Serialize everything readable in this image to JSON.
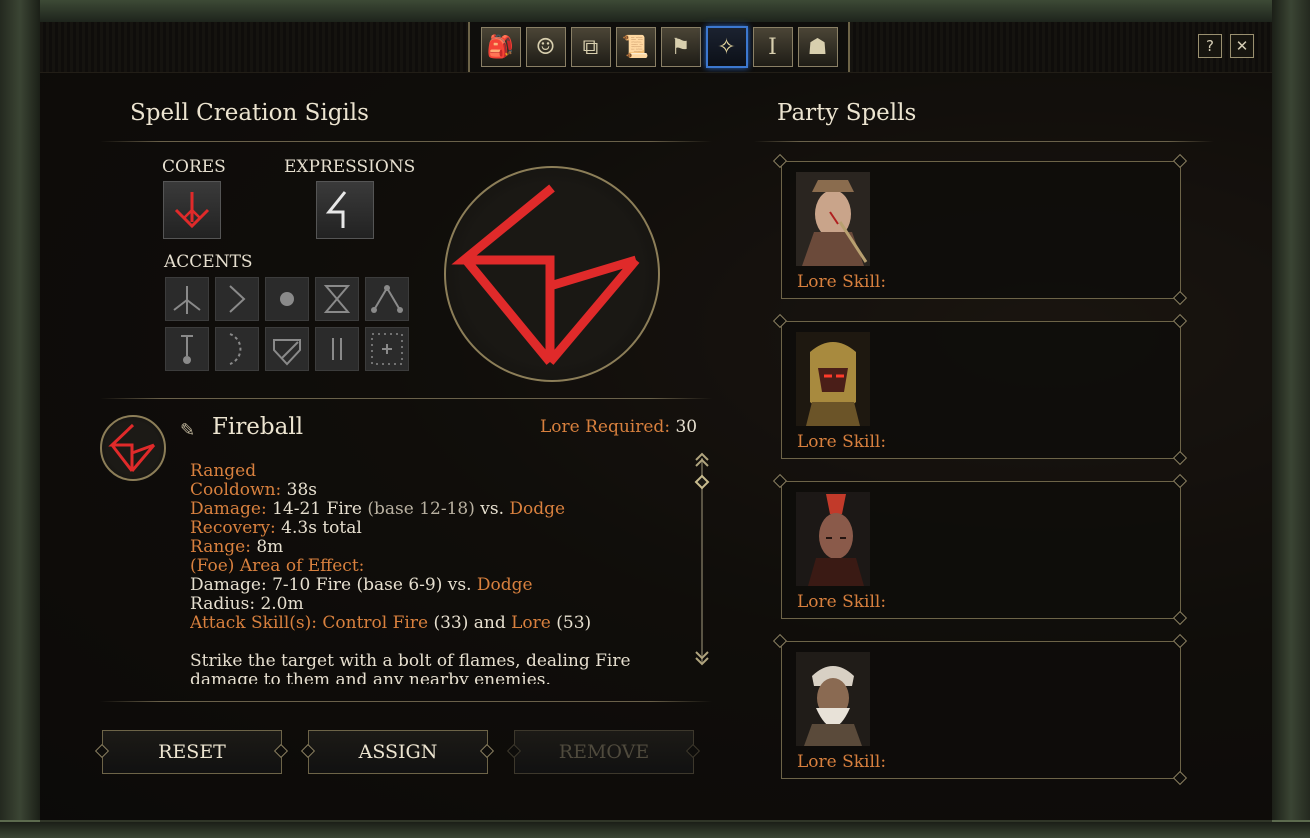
{
  "window": {
    "tabs": [
      {
        "name": "inventory-tab-icon",
        "glyph": "🎒"
      },
      {
        "name": "character-tab-icon",
        "glyph": "☺"
      },
      {
        "name": "party-tab-icon",
        "glyph": "⧉"
      },
      {
        "name": "journal-tab-icon",
        "glyph": "📜"
      },
      {
        "name": "reputation-tab-icon",
        "glyph": "⚑"
      },
      {
        "name": "grimoire-tab-icon",
        "glyph": "✧"
      },
      {
        "name": "stronghold-tab-icon",
        "glyph": "Ⅰ"
      },
      {
        "name": "map-tab-icon",
        "glyph": "☗"
      }
    ],
    "active_tab": 5,
    "help_label": "?",
    "close_label": "✕"
  },
  "left": {
    "title": "Spell Creation Sigils",
    "cores_label": "CORES",
    "expressions_label": "EXPRESSIONS",
    "accents_label": "ACCENTS",
    "spell": {
      "name": "Fireball",
      "lore_required_label": "Lore Required:",
      "lore_required_value": "30",
      "lines": [
        {
          "label": "Ranged",
          "value": ""
        },
        {
          "label": "Cooldown:",
          "value": "38s"
        },
        {
          "label": "Damage:",
          "value": "14-21 Fire",
          "extra": "(base 12-18)",
          "vs": "vs.",
          "target": "Dodge"
        },
        {
          "label": "Recovery:",
          "value": "4.3s total"
        },
        {
          "label": "Range:",
          "value": "8m"
        },
        {
          "label": "(Foe) Area of Effect:",
          "value": ""
        },
        {
          "plain": "Damage: 7-10 Fire (base 6-9) vs.",
          "target": "Dodge"
        },
        {
          "plain": "Radius: 2.0m"
        },
        {
          "label": "Attack Skill(s):",
          "skill1": "Control Fire",
          "skill1_val": "(33)",
          "and": "and",
          "skill2": "Lore",
          "skill2_val": "(53)"
        }
      ],
      "description": "Strike the target with a bolt of flames, dealing Fire damage to them and any nearby enemies."
    },
    "buttons": {
      "reset": "RESET",
      "assign": "ASSIGN",
      "remove": "REMOVE"
    }
  },
  "right": {
    "title": "Party Spells",
    "members": [
      {
        "lore_label": "Lore Skill:",
        "palette": [
          "#c9a48a",
          "#6b4a3a",
          "#8a6c4e"
        ]
      },
      {
        "lore_label": "Lore Skill:",
        "palette": [
          "#a88a3e",
          "#4a1e18",
          "#6b5428"
        ]
      },
      {
        "lore_label": "Lore Skill:",
        "palette": [
          "#8a5a4a",
          "#3a1a14",
          "#c23a2a"
        ]
      },
      {
        "lore_label": "Lore Skill:",
        "palette": [
          "#d8d0c4",
          "#8a6a52",
          "#5a4a3a"
        ]
      }
    ]
  },
  "colors": {
    "accent_orange": "#d8803e",
    "sigil_red": "#e02a2a",
    "active_tab_blue": "#3c78d0"
  }
}
